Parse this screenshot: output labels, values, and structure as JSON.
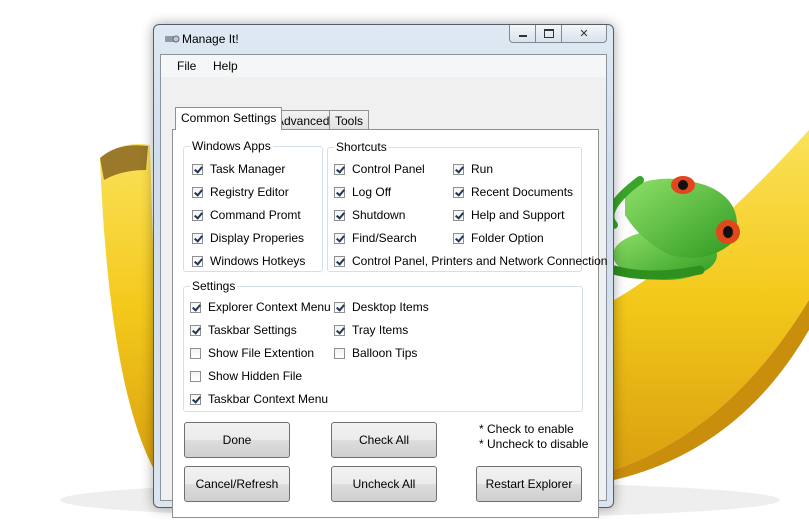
{
  "window": {
    "title": "Manage It!"
  },
  "menu": [
    "File",
    "Help"
  ],
  "tabs": [
    "Common Settings",
    "Advanced",
    "Tools"
  ],
  "windows_apps": {
    "legend": "Windows Apps",
    "items": [
      {
        "label": "Task Manager",
        "checked": true
      },
      {
        "label": "Registry Editor",
        "checked": true
      },
      {
        "label": "Command Promt",
        "checked": true
      },
      {
        "label": "Display Properies",
        "checked": true
      },
      {
        "label": "Windows Hotkeys",
        "checked": true
      }
    ]
  },
  "shortcuts": {
    "legend": "Shortcuts",
    "left": [
      {
        "label": "Control Panel",
        "checked": true
      },
      {
        "label": "Log Off",
        "checked": true
      },
      {
        "label": "Shutdown",
        "checked": true
      },
      {
        "label": "Find/Search",
        "checked": true
      }
    ],
    "right": [
      {
        "label": "Run",
        "checked": true
      },
      {
        "label": "Recent Documents",
        "checked": true
      },
      {
        "label": "Help and Support",
        "checked": true
      },
      {
        "label": "Folder Option",
        "checked": true
      }
    ],
    "wide": {
      "label": "Control Panel, Printers and Network Connection",
      "checked": true
    }
  },
  "settings": {
    "legend": "Settings",
    "left": [
      {
        "label": "Explorer Context Menu",
        "checked": true
      },
      {
        "label": "Taskbar Settings",
        "checked": true
      },
      {
        "label": "Show File Extention",
        "checked": false
      },
      {
        "label": "Show Hidden File",
        "checked": false
      },
      {
        "label": "Taskbar Context Menu",
        "checked": true
      }
    ],
    "right": [
      {
        "label": "Desktop Items",
        "checked": true
      },
      {
        "label": "Tray Items",
        "checked": true
      },
      {
        "label": "Balloon Tips",
        "checked": false
      }
    ]
  },
  "buttons": {
    "done": "Done",
    "check_all": "Check All",
    "cancel": "Cancel/Refresh",
    "uncheck_all": "Uncheck All",
    "restart": "Restart Explorer"
  },
  "notes": [
    "* Check to enable",
    "* Uncheck to disable"
  ],
  "colors": {
    "banana": "#f3c81a",
    "frog": "#3aa52a",
    "frog_eye": "#e2461c"
  }
}
